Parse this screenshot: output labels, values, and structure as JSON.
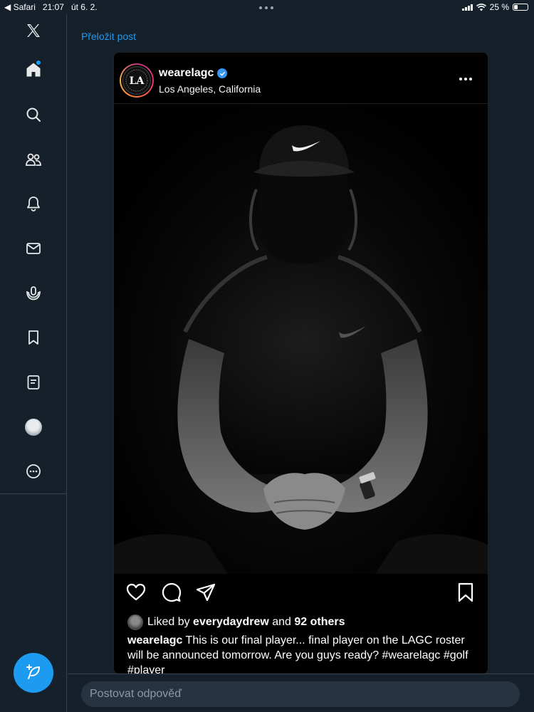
{
  "status_bar": {
    "back_app": "Safari",
    "time": "21:07",
    "date": "út 6. 2.",
    "battery_percent": "25 %"
  },
  "sidebar": {
    "items": [
      {
        "name": "x-logo-icon"
      },
      {
        "name": "home-icon"
      },
      {
        "name": "search-icon"
      },
      {
        "name": "communities-icon"
      },
      {
        "name": "notifications-icon"
      },
      {
        "name": "messages-icon"
      },
      {
        "name": "spaces-icon"
      },
      {
        "name": "bookmarks-icon"
      },
      {
        "name": "lists-icon"
      },
      {
        "name": "profile-avatar"
      },
      {
        "name": "more-icon"
      }
    ],
    "compose_icon": "compose-feather-icon"
  },
  "post": {
    "translate_link": "Přeložit post",
    "embed": {
      "username": "wearelagc",
      "location": "Los Angeles, California",
      "logo_text": "LA",
      "liked_prefix": "Liked by",
      "liked_user": "everydaydrew",
      "liked_middle": "and",
      "liked_count": "92 others",
      "caption_user": "wearelagc",
      "caption_text": "This is our final player... final player on the LAGC roster will be announced tomorrow. Are you guys ready? #wearelagc #golf #player"
    }
  },
  "reply": {
    "placeholder": "Postovat odpověď"
  },
  "colors": {
    "background": "#15202b",
    "accent": "#1d9bf0",
    "border": "#38444d",
    "reply_field": "#273340"
  }
}
